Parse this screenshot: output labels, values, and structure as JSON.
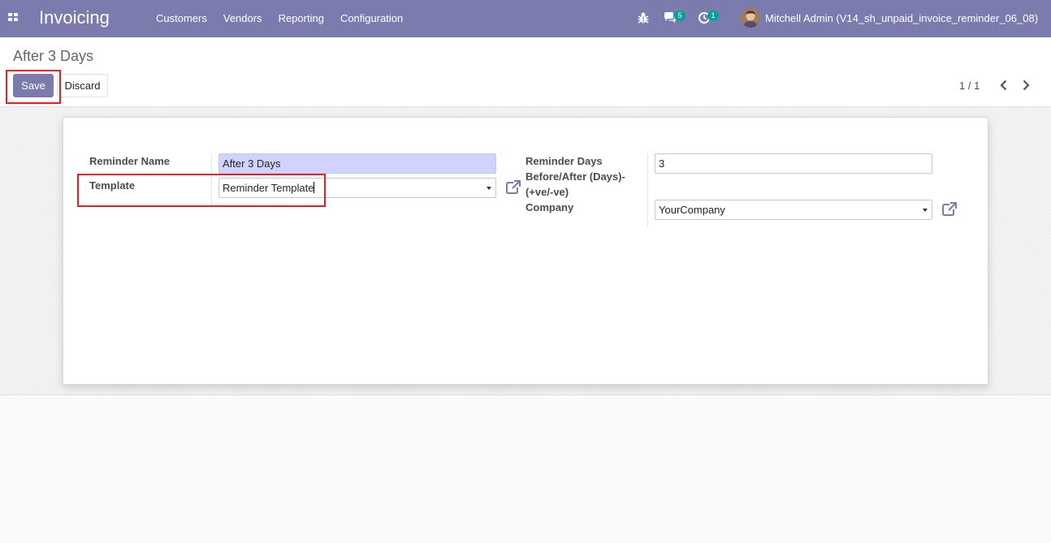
{
  "navbar": {
    "apps_icon": "apps-grid-icon",
    "brand": "Invoicing",
    "menu": [
      "Customers",
      "Vendors",
      "Reporting",
      "Configuration"
    ],
    "debug_icon": "bug-icon",
    "messages_icon": "chat-icon",
    "messages_count": "5",
    "activities_icon": "clock-icon",
    "activities_count": "1",
    "user_name": "Mitchell Admin (V14_sh_unpaid_invoice_reminder_06_08)"
  },
  "control_panel": {
    "title": "After 3 Days",
    "save_label": "Save",
    "discard_label": "Discard",
    "pager": "1 / 1"
  },
  "form": {
    "reminder_name_label": "Reminder Name",
    "reminder_name_value": "After 3 Days",
    "template_label": "Template",
    "template_value": "Reminder Template",
    "days_label_lines": [
      "Reminder Days",
      "Before/After (Days)-",
      "(+ve/-ve)"
    ],
    "days_value": "3",
    "company_label": "Company",
    "company_value": "YourCompany"
  },
  "colors": {
    "brand": "#7c7bad",
    "badge": "#00a09d",
    "required_field": "#d2d2ff",
    "highlight": "#e31e24"
  }
}
